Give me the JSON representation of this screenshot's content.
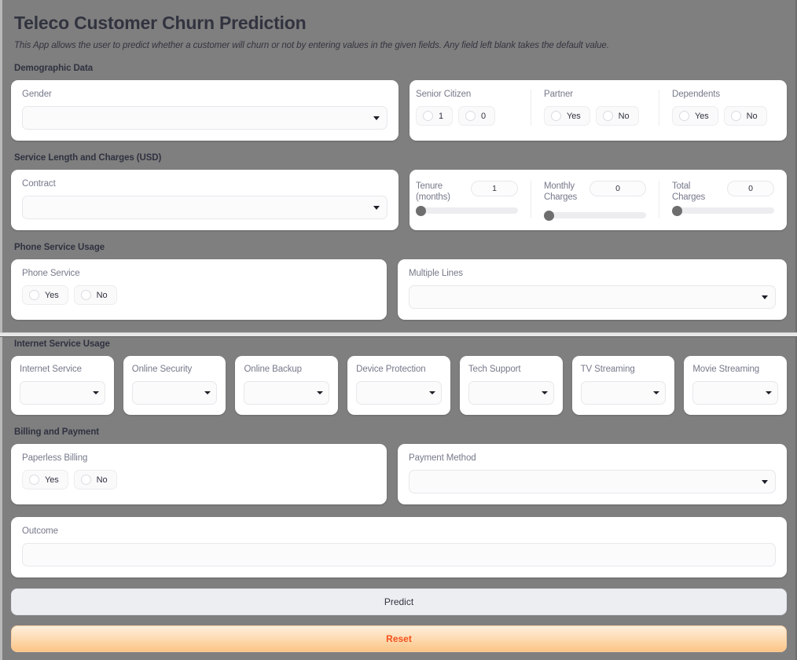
{
  "header": {
    "title": "Teleco Customer Churn Prediction",
    "subtitle": "This App allows the user to predict whether a customer will churn or not by entering values in the given fields. Any field left blank takes the default value."
  },
  "sections": {
    "demographic": "Demographic Data",
    "service_length": "Service Length and Charges (USD)",
    "phone": "Phone Service Usage",
    "internet": "Internet Service Usage",
    "billing": "Billing and Payment"
  },
  "gender": {
    "label": "Gender",
    "value": ""
  },
  "senior_citizen": {
    "label": "Senior Citizen",
    "options": [
      "1",
      "0"
    ]
  },
  "partner": {
    "label": "Partner",
    "options": [
      "Yes",
      "No"
    ]
  },
  "dependents": {
    "label": "Dependents",
    "options": [
      "Yes",
      "No"
    ]
  },
  "contract": {
    "label": "Contract",
    "value": ""
  },
  "tenure": {
    "label": "Tenure (months)",
    "value": "1",
    "fill_pct": 0
  },
  "monthly_charges": {
    "label": "Monthly Charges",
    "value": "0",
    "fill_pct": 0
  },
  "total_charges": {
    "label": "Total Charges",
    "value": "0",
    "fill_pct": 0
  },
  "phone_service": {
    "label": "Phone Service",
    "options": [
      "Yes",
      "No"
    ]
  },
  "multiple_lines": {
    "label": "Multiple Lines",
    "value": ""
  },
  "internet_service": {
    "label": "Internet Service",
    "value": ""
  },
  "online_security": {
    "label": "Online Security",
    "value": ""
  },
  "online_backup": {
    "label": "Online Backup",
    "value": ""
  },
  "device_protection": {
    "label": "Device Protection",
    "value": ""
  },
  "tech_support": {
    "label": "Tech Support",
    "value": ""
  },
  "tv_streaming": {
    "label": "TV Streaming",
    "value": ""
  },
  "movie_streaming": {
    "label": "Movie Streaming",
    "value": ""
  },
  "paperless_billing": {
    "label": "Paperless Billing",
    "options": [
      "Yes",
      "No"
    ]
  },
  "payment_method": {
    "label": "Payment Method",
    "value": ""
  },
  "outcome": {
    "label": "Outcome",
    "value": ""
  },
  "buttons": {
    "predict": "Predict",
    "reset": "Reset"
  },
  "colors": {
    "background": "#7f7f7f",
    "card": "#ffffff",
    "text": "#31333f",
    "label": "#76798a",
    "reset_text": "#f4511e",
    "reset_bg_top": "#fdeedb",
    "reset_bg_bottom": "#fcc486",
    "predict_bg": "#eceef2",
    "slider_thumb": "#6e6e6e",
    "slider_track": "#ededf0"
  }
}
